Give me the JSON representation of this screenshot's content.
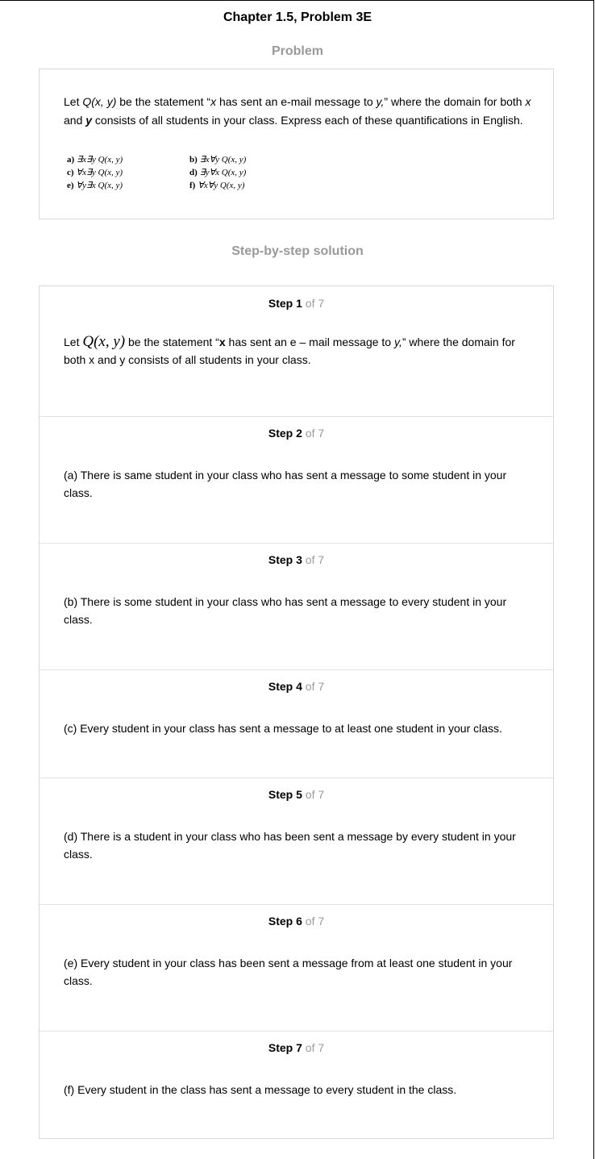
{
  "header": {
    "title": "Chapter 1.5, Problem 3E"
  },
  "problem": {
    "heading": "Problem",
    "text_parts": [
      "Let ",
      "Q(x, y)",
      " be the statement “",
      "x",
      " has sent an e-mail message to ",
      "y,",
      "” where the domain for both ",
      "x",
      " and ",
      "y",
      " consists of all students in your class. Express each of these quantifications in English."
    ],
    "items": [
      {
        "label": "a)",
        "expr": "∃x∃y Q(x, y)"
      },
      {
        "label": "b)",
        "expr": "∃x∀y Q(x, y)"
      },
      {
        "label": "c)",
        "expr": "∀x∃y Q(x, y)"
      },
      {
        "label": "d)",
        "expr": "∃y∀x Q(x, y)"
      },
      {
        "label": "e)",
        "expr": "∀y∃x Q(x, y)"
      },
      {
        "label": "f)",
        "expr": "∀x∀y Q(x, y)"
      }
    ]
  },
  "solution": {
    "heading": "Step-by-step solution",
    "step_word": "Step",
    "of_template": "of 7",
    "steps": [
      {
        "number": "1",
        "text_parts": [
          "Let ",
          "Q(x, y)",
          " be the statement “",
          "x",
          " has sent an e – mail message to ",
          "y,",
          "” where the domain for both x and y consists of all students in your class."
        ]
      },
      {
        "number": "2",
        "text": "(a) There is same student in your class who has sent a message to some student in your class."
      },
      {
        "number": "3",
        "text": "(b) There is some student in your class who has sent a message to every student in your class."
      },
      {
        "number": "4",
        "text": "(c) Every student in your class has sent a message to at least one student in your class."
      },
      {
        "number": "5",
        "text": "(d) There is a student in your class who has been sent a message by every student in your class."
      },
      {
        "number": "6",
        "text": "(e) Every student in your class has been sent a message from at least one student in your class."
      },
      {
        "number": "7",
        "text": "(f) Every student in the class has sent a message to every student in the class."
      }
    ]
  }
}
